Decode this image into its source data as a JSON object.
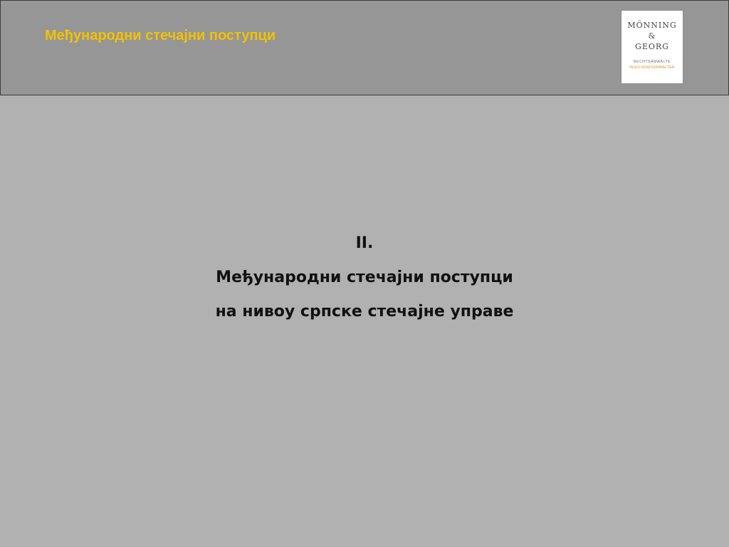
{
  "header": {
    "title": "Међународни стечајни поступци"
  },
  "logo": {
    "name_line1": "MÖNNING",
    "name_line2": "&",
    "name_line3": "GEORG",
    "subtitle1": "RECHTSANWÄLTE",
    "subtitle2": "INSOLVENZVERWALTER"
  },
  "content": {
    "numeral": "II.",
    "line1": "Међународни стечајни поступци",
    "line2": "на нивоу српске стечајне управе"
  },
  "colors": {
    "title": "#f2c200",
    "header_background": "#969696",
    "slide_background": "#b1b1b1",
    "logo_accent": "#d9901a"
  }
}
